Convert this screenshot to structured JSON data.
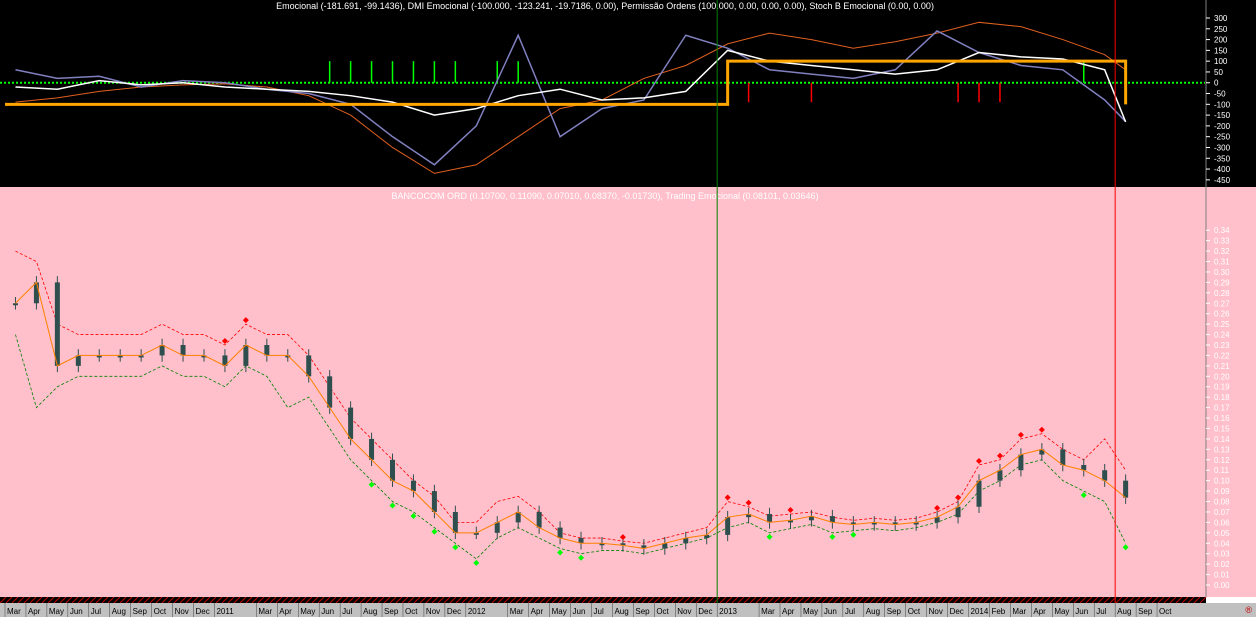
{
  "upper_title": "Emocional (-181.691, -99.1436), DMI Emocional (-100.000, -123.241, -19.7186, 0.00), Permissão Ordens (100.000, 0.00, 0.00, 0.00), Stoch B Emocional (0.00, 0.00)",
  "lower_title": "BANCOCOM ORD (0.10700, 0.11090, 0.07010, 0.08370, -0.01730), Trading Emocional (0.08101, 0.03646)",
  "corner_mark": "®",
  "colors": {
    "upper_bg": "#000000",
    "lower_bg": "#ffc0cb",
    "permission_line": "#ffa500",
    "emocional_line": "#ffffff",
    "dmi_line": "#8080c0",
    "slow_line": "#e06020",
    "bull_bar": "#00ff00",
    "bear_bar": "#ff0000",
    "candle": "#2f4f4f",
    "trading_line": "#ff8000",
    "upper_band": "#ff0000",
    "lower_band": "#008000",
    "buy_marker": "#00ff00",
    "sell_marker": "#ff0000",
    "vline_green": "#008000",
    "vline_red": "#ff0000"
  },
  "chart_data": [
    {
      "type": "line",
      "title": "Emocional (-181.691, -99.1436), DMI Emocional (-100.000, -123.241, -19.7186, 0.00), Permissão Ordens (100.000, 0.00, 0.00, 0.00), Stoch B Emocional (0.00, 0.00)",
      "y_ticks": [
        300,
        250,
        200,
        150,
        100,
        50,
        0,
        -50,
        -100,
        -150,
        -200,
        -250,
        -300,
        -350,
        -400,
        -450
      ],
      "ylim": [
        -460,
        300
      ],
      "x": [
        "2010-03",
        "2010-05",
        "2010-07",
        "2010-09",
        "2010-11",
        "2011-01",
        "2011-03",
        "2011-05",
        "2011-07",
        "2011-09",
        "2011-11",
        "2012-01",
        "2012-03",
        "2012-05",
        "2012-07",
        "2012-09",
        "2012-11",
        "2013-01",
        "2013-03",
        "2013-05",
        "2013-07",
        "2013-09",
        "2013-11",
        "2014-01",
        "2014-03",
        "2014-05",
        "2014-07",
        "2014-08"
      ],
      "series": [
        {
          "name": "Permissão Ordens",
          "values": [
            -100,
            -100,
            -100,
            -100,
            -100,
            -100,
            -100,
            -100,
            -100,
            -100,
            -100,
            -100,
            -100,
            -100,
            -100,
            -100,
            -100,
            100,
            100,
            100,
            100,
            100,
            100,
            100,
            100,
            100,
            100,
            -100
          ]
        },
        {
          "name": "Emocional",
          "values": [
            -20,
            -30,
            10,
            -10,
            0,
            -20,
            -30,
            -40,
            -60,
            -90,
            -150,
            -120,
            -60,
            -30,
            -80,
            -70,
            -40,
            150,
            100,
            80,
            60,
            40,
            60,
            140,
            120,
            110,
            60,
            -181.691
          ]
        },
        {
          "name": "DMI Emocional",
          "values": [
            60,
            20,
            30,
            -20,
            10,
            0,
            -30,
            -50,
            -100,
            -250,
            -380,
            -200,
            220,
            -250,
            -120,
            -80,
            220,
            160,
            60,
            40,
            20,
            60,
            240,
            140,
            80,
            60,
            -80,
            -180
          ]
        },
        {
          "name": "Stoch B Emocional",
          "values": [
            -90,
            -70,
            -40,
            -20,
            -10,
            -5,
            -20,
            -60,
            -150,
            -300,
            -420,
            -380,
            -250,
            -120,
            -80,
            20,
            80,
            180,
            230,
            200,
            160,
            190,
            230,
            280,
            260,
            200,
            130,
            60
          ]
        }
      ],
      "signal_bars": {
        "bull": [
          "2011-06",
          "2011-07",
          "2011-08",
          "2011-09",
          "2011-10",
          "2011-11",
          "2011-12",
          "2012-02",
          "2012-03",
          "2014-06",
          "2014-08"
        ],
        "bear": [
          "2013-01",
          "2013-02",
          "2013-05",
          "2013-12",
          "2014-01",
          "2014-02"
        ]
      }
    },
    {
      "type": "candlestick",
      "title": "BANCOCOM ORD (0.10700, 0.11090, 0.07010, 0.08370, -0.01730), Trading Emocional (0.08101, 0.03646)",
      "ohlc_last": {
        "open": 0.107,
        "high": 0.1109,
        "low": 0.0701,
        "close": 0.0837,
        "change": -0.0173
      },
      "trading_emocional_last": [
        0.08101,
        0.03646
      ],
      "y_ticks": [
        0.34,
        0.33,
        0.32,
        0.31,
        0.3,
        0.29,
        0.28,
        0.27,
        0.26,
        0.25,
        0.24,
        0.23,
        0.22,
        0.21,
        0.2,
        0.19,
        0.18,
        0.17,
        0.16,
        0.15,
        0.14,
        0.13,
        0.12,
        0.11,
        0.1,
        0.09,
        0.08,
        0.07,
        0.06,
        0.05,
        0.04,
        0.03,
        0.02,
        0.01,
        0.0
      ],
      "ylim": [
        0.0,
        0.345
      ],
      "x": [
        "2010-03",
        "2010-04",
        "2010-05",
        "2010-06",
        "2010-07",
        "2010-08",
        "2010-09",
        "2010-10",
        "2010-11",
        "2010-12",
        "2011-01",
        "2011-02",
        "2011-03",
        "2011-04",
        "2011-05",
        "2011-06",
        "2011-07",
        "2011-08",
        "2011-09",
        "2011-10",
        "2011-11",
        "2011-12",
        "2012-01",
        "2012-02",
        "2012-03",
        "2012-04",
        "2012-05",
        "2012-06",
        "2012-07",
        "2012-08",
        "2012-09",
        "2012-10",
        "2012-11",
        "2012-12",
        "2013-01",
        "2013-02",
        "2013-03",
        "2013-04",
        "2013-05",
        "2013-06",
        "2013-07",
        "2013-08",
        "2013-09",
        "2013-10",
        "2013-11",
        "2013-12",
        "2014-01",
        "2014-02",
        "2014-03",
        "2014-04",
        "2014-05",
        "2014-06",
        "2014-07",
        "2014-08"
      ],
      "values": [
        0.27,
        0.29,
        0.21,
        0.22,
        0.22,
        0.22,
        0.22,
        0.23,
        0.22,
        0.22,
        0.21,
        0.23,
        0.22,
        0.22,
        0.2,
        0.17,
        0.14,
        0.12,
        0.1,
        0.09,
        0.07,
        0.05,
        0.05,
        0.06,
        0.07,
        0.055,
        0.045,
        0.04,
        0.04,
        0.038,
        0.035,
        0.04,
        0.045,
        0.048,
        0.065,
        0.068,
        0.06,
        0.062,
        0.066,
        0.06,
        0.058,
        0.06,
        0.058,
        0.06,
        0.065,
        0.075,
        0.1,
        0.11,
        0.125,
        0.13,
        0.115,
        0.11,
        0.1,
        0.0837
      ],
      "upper_band": [
        0.32,
        0.31,
        0.25,
        0.24,
        0.24,
        0.24,
        0.24,
        0.25,
        0.24,
        0.24,
        0.23,
        0.25,
        0.24,
        0.24,
        0.22,
        0.19,
        0.16,
        0.14,
        0.12,
        0.1,
        0.085,
        0.06,
        0.06,
        0.08,
        0.085,
        0.07,
        0.05,
        0.045,
        0.045,
        0.042,
        0.04,
        0.045,
        0.05,
        0.055,
        0.08,
        0.075,
        0.066,
        0.068,
        0.07,
        0.065,
        0.062,
        0.064,
        0.062,
        0.064,
        0.07,
        0.08,
        0.115,
        0.12,
        0.14,
        0.145,
        0.13,
        0.12,
        0.14,
        0.11
      ],
      "lower_band": [
        0.24,
        0.17,
        0.19,
        0.2,
        0.2,
        0.2,
        0.2,
        0.21,
        0.2,
        0.2,
        0.19,
        0.21,
        0.2,
        0.17,
        0.18,
        0.15,
        0.12,
        0.1,
        0.08,
        0.07,
        0.055,
        0.04,
        0.025,
        0.045,
        0.055,
        0.045,
        0.035,
        0.03,
        0.033,
        0.033,
        0.03,
        0.035,
        0.04,
        0.045,
        0.055,
        0.06,
        0.05,
        0.054,
        0.058,
        0.05,
        0.052,
        0.054,
        0.052,
        0.055,
        0.06,
        0.068,
        0.09,
        0.1,
        0.115,
        0.12,
        0.1,
        0.09,
        0.08,
        0.04
      ],
      "sell_markers": [
        "2011-01",
        "2011-02",
        "2012-08",
        "2013-01",
        "2013-02",
        "2013-04",
        "2013-11",
        "2013-12",
        "2014-01",
        "2014-02",
        "2014-03",
        "2014-04"
      ],
      "buy_markers": [
        "2011-08",
        "2011-09",
        "2011-10",
        "2011-11",
        "2011-12",
        "2012-01",
        "2012-05",
        "2012-06",
        "2013-03",
        "2013-06",
        "2013-07",
        "2014-06",
        "2014-08"
      ]
    }
  ],
  "x_axis_labels": [
    "Mar",
    "Apr",
    "May",
    "Jun",
    "Jul",
    "Aug",
    "Sep",
    "Oct",
    "Nov",
    "Dec",
    "2011",
    "Mar",
    "Apr",
    "May",
    "Jun",
    "Jul",
    "Aug",
    "Sep",
    "Oct",
    "Nov",
    "Dec",
    "2012",
    "Mar",
    "Apr",
    "May",
    "Jun",
    "Jul",
    "Aug",
    "Sep",
    "Oct",
    "Nov",
    "Dec",
    "2013",
    "Mar",
    "Apr",
    "May",
    "Jun",
    "Jul",
    "Aug",
    "Sep",
    "Oct",
    "Nov",
    "Dec",
    "2014",
    "Feb",
    "Mar",
    "Apr",
    "May",
    "Jun",
    "Jul",
    "Aug",
    "Sep",
    "Oct"
  ],
  "x_axis_months": [
    "2010-03",
    "2010-04",
    "2010-05",
    "2010-06",
    "2010-07",
    "2010-08",
    "2010-09",
    "2010-10",
    "2010-11",
    "2010-12",
    "2011-01",
    "2011-03",
    "2011-04",
    "2011-05",
    "2011-06",
    "2011-07",
    "2011-08",
    "2011-09",
    "2011-10",
    "2011-11",
    "2011-12",
    "2012-01",
    "2012-03",
    "2012-04",
    "2012-05",
    "2012-06",
    "2012-07",
    "2012-08",
    "2012-09",
    "2012-10",
    "2012-11",
    "2012-12",
    "2013-01",
    "2013-03",
    "2013-04",
    "2013-05",
    "2013-06",
    "2013-07",
    "2013-08",
    "2013-09",
    "2013-10",
    "2013-11",
    "2013-12",
    "2014-01",
    "2014-02",
    "2014-03",
    "2014-04",
    "2014-05",
    "2014-06",
    "2014-07",
    "2014-08",
    "2014-09",
    "2014-10"
  ],
  "marker_lines": [
    {
      "name": "green",
      "month": "2013-01"
    },
    {
      "name": "red",
      "month": "2014-08"
    }
  ]
}
